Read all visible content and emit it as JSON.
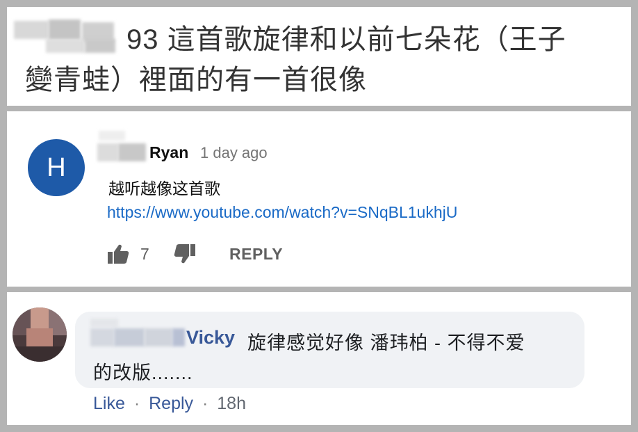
{
  "post": {
    "text_line1": "93 這首歌旋律和以前七朵花（王子",
    "text_line2": "變青蛙）裡面的有一首很像"
  },
  "youtube_comment": {
    "avatar_letter": "H",
    "author": "Ryan",
    "time": "1 day ago",
    "body": "越听越像这首歌",
    "link": "https://www.youtube.com/watch?v=SNqBL1ukhjU",
    "like_count": "7",
    "reply_label": "REPLY"
  },
  "facebook_comment": {
    "author": "Vicky",
    "text_line1": "旋律感觉好像 潘玮柏 - 不得不爱",
    "text_line2": "的改版.......",
    "like_label": "Like",
    "separator1": "·",
    "reply_label": "Reply",
    "separator2": "·",
    "timestamp": "18h"
  },
  "colors": {
    "youtube_avatar": "#1e5aa8",
    "youtube_link": "#1a6ac6",
    "facebook_blue": "#385898"
  }
}
